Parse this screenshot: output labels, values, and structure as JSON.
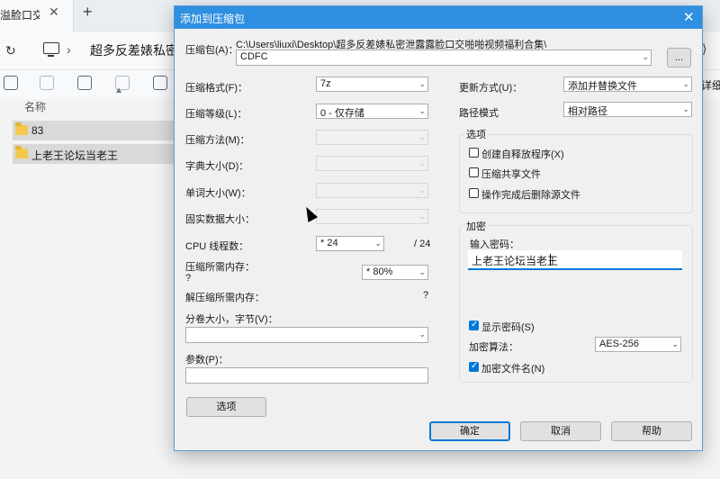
{
  "explorer": {
    "tab_title": "溢脸口交啪",
    "tab_close": "✕",
    "new_tab": "+",
    "breadcrumb": "超多反差婊私密泄",
    "breadcrumb_sep": "›",
    "refresh": "↻",
    "more": "⟩",
    "details_label": "详细信",
    "column_name": "名称",
    "sort_indicator": "▲",
    "items": [
      {
        "name": "83"
      },
      {
        "name": "上老王论坛当老王"
      }
    ]
  },
  "dialog": {
    "title": "添加到压缩包",
    "close": "✕",
    "archive_label": "压缩包(A)：",
    "archive_path": "C:\\Users\\liuxi\\Desktop\\超多反差婊私密泄露露脸口交啪啪视频福利合集\\",
    "archive_name": "CDFC",
    "browse_label": "...",
    "format_label": "压缩格式(F)：",
    "format_value": "7z",
    "level_label": "压缩等级(L)：",
    "level_value": "0 - 仅存储",
    "method_label": "压缩方法(M)：",
    "dict_label": "字典大小(D)：",
    "word_label": "单词大小(W)：",
    "solid_label": "固实数据大小：",
    "cpu_label": "CPU 线程数：",
    "cpu_value": "* 24",
    "cpu_total": "/ 24",
    "mem_comp_label": "压缩所需内存：",
    "mem_comp_q": "?",
    "mem_comp_value": "* 80%",
    "mem_decomp_label": "解压缩所需内存：",
    "mem_decomp_q": "?",
    "split_label": "分卷大小，字节(V)：",
    "params_label": "参数(P)：",
    "options_btn": "选项",
    "update_label": "更新方式(U)：",
    "update_value": "添加并替换文件",
    "path_label": "路径模式",
    "path_value": "相对路径",
    "options_group": "选项",
    "opt_sfx": "创建自释放程序(X)",
    "opt_shared": "压缩共享文件",
    "opt_delete": "操作完成后删除源文件",
    "encrypt_group": "加密",
    "password_label": "输入密码：",
    "password_value": "上老王论坛当老王",
    "show_password": "显示密码(S)",
    "enc_method_label": "加密算法：",
    "enc_method_value": "AES-256",
    "enc_names": "加密文件名(N)",
    "ok": "确定",
    "cancel": "取消",
    "help": "帮助",
    "dropdown_arrow": "⌄"
  }
}
